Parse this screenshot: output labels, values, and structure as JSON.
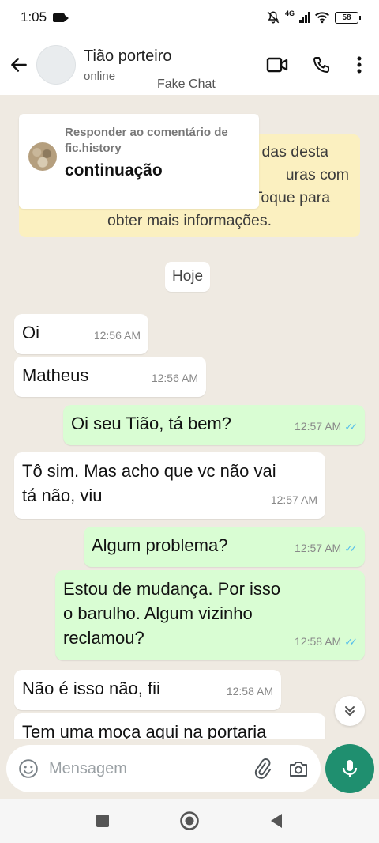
{
  "status_bar": {
    "time": "1:05",
    "network": "4G",
    "battery": "58"
  },
  "header": {
    "contact_name": "Tião porteiro",
    "contact_status": "online",
    "watermark": "Fake Chat"
  },
  "reply_card": {
    "caption": "Responder ao comentário de fic.history",
    "title": "continuação"
  },
  "encryption_notice": {
    "line1": "das desta",
    "line2": "uras com",
    "line3": "criptografia de ponta a ponta. Toque para",
    "line4": "obter mais informações."
  },
  "date_chip": "Hoje",
  "messages": [
    {
      "dir": "in",
      "text": "Oi",
      "time": "12:56 AM"
    },
    {
      "dir": "in",
      "text": "Matheus",
      "time": "12:56 AM"
    },
    {
      "dir": "out",
      "text": "Oi seu Tião, tá bem?",
      "time": "12:57 AM",
      "ticks": "✓✓"
    },
    {
      "dir": "in",
      "line1": "Tô sim. Mas acho que vc não vai",
      "line2": "tá não, viu",
      "time": "12:57 AM"
    },
    {
      "dir": "out",
      "text": "Algum problema?",
      "time": "12:57 AM",
      "ticks": "✓✓"
    },
    {
      "dir": "out",
      "line1": "Estou de mudança. Por isso",
      "line2": "o barulho. Algum vizinho",
      "line3": "reclamou?",
      "time": "12:58 AM",
      "ticks": "✓✓"
    },
    {
      "dir": "in",
      "text": "Não é isso não, fii",
      "time": "12:58 AM"
    },
    {
      "dir": "in",
      "text": "Tem uma moça aqui na portaria"
    }
  ],
  "input": {
    "placeholder": "Mensagem"
  },
  "colors": {
    "chat_background": "#efeae2",
    "outgoing_bubble": "#d9fdd3",
    "incoming_bubble": "#ffffff",
    "accent": "#1f8f6f",
    "read_ticks": "#53bdeb"
  },
  "icons": [
    "back-arrow-icon",
    "video-call-icon",
    "phone-icon",
    "more-vert-icon",
    "emoji-icon",
    "attach-icon",
    "camera-icon",
    "mic-icon",
    "scroll-down-icon"
  ]
}
